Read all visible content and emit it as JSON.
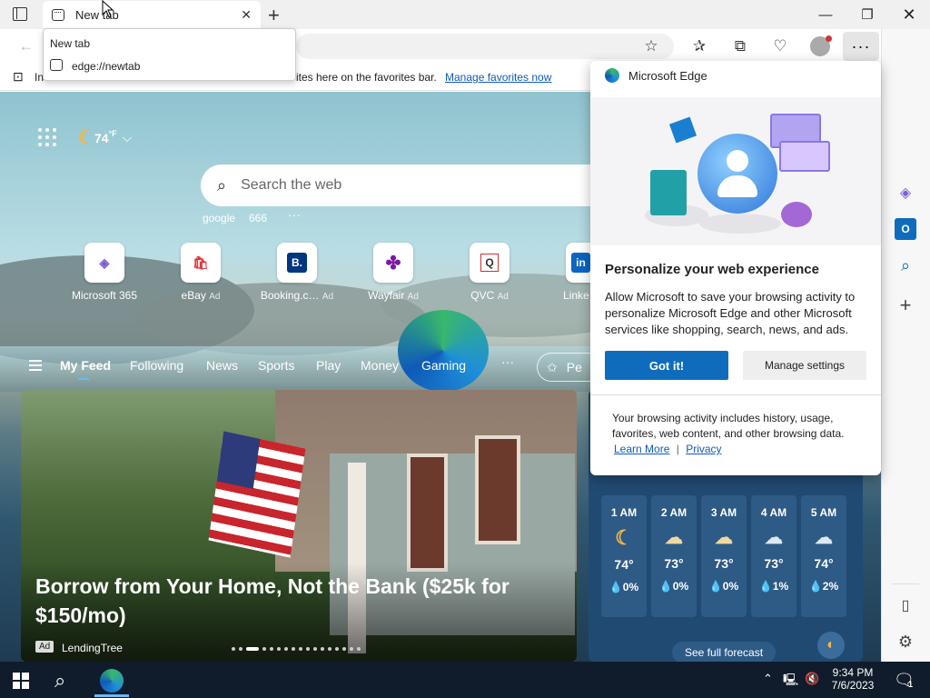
{
  "browser": {
    "tab_title": "New tab",
    "tab_tooltip": {
      "title": "New tab",
      "url": "edge://newtab"
    },
    "favorites_bar": {
      "prefix": "In",
      "message": "ites here on the favorites bar.",
      "link": "Manage favorites now"
    }
  },
  "newtab": {
    "weather_temp": "74",
    "weather_unit": "°F",
    "search_placeholder": "Search the web",
    "quick_links": [
      "google",
      "666"
    ],
    "sites": [
      {
        "label": "Microsoft 365",
        "ad": ""
      },
      {
        "label": "eBay",
        "ad": "Ad"
      },
      {
        "label": "Booking.c…",
        "ad": "Ad"
      },
      {
        "label": "Wayfair",
        "ad": "Ad"
      },
      {
        "label": "QVC",
        "ad": "Ad"
      },
      {
        "label": "Linke",
        "ad": ""
      }
    ],
    "nav_items": [
      "My Feed",
      "Following",
      "News",
      "Sports",
      "Play",
      "Money",
      "Gaming"
    ],
    "personalize_short": "Pe",
    "feature_card": {
      "title": "Borrow from Your Home, Not the Bank ($25k for $150/mo)",
      "ad_badge": "Ad",
      "source": "LendingTree"
    },
    "weather_card": {
      "hours": [
        {
          "time": "1 AM",
          "temp": "74°",
          "precip": "0%",
          "icon": "moon-icon"
        },
        {
          "time": "2 AM",
          "temp": "73°",
          "precip": "0%",
          "icon": "partly-cloudy-night-icon"
        },
        {
          "time": "3 AM",
          "temp": "73°",
          "precip": "0%",
          "icon": "partly-cloudy-night-icon"
        },
        {
          "time": "4 AM",
          "temp": "73°",
          "precip": "1%",
          "icon": "cloud-icon"
        },
        {
          "time": "5 AM",
          "temp": "74°",
          "precip": "2%",
          "icon": "cloud-icon"
        }
      ],
      "forecast_button": "See full forecast"
    }
  },
  "popup": {
    "brand": "Microsoft Edge",
    "heading": "Personalize your web experience",
    "body": "Allow Microsoft to save your browsing activity to personalize Microsoft Edge and other Microsoft services like shopping, search, news, and ads.",
    "primary_button": "Got it!",
    "secondary_button": "Manage settings",
    "footer": "Your browsing activity includes history, usage, favorites, web content, and other browsing data.",
    "learn_more": "Learn More",
    "separator": "|",
    "privacy": "Privacy"
  },
  "taskbar": {
    "time": "9:34 PM",
    "date": "7/6/2023",
    "notification_count": "1"
  },
  "colors": {
    "accent": "#0f6cbd",
    "link": "#0f5ab9",
    "taskbar": "#101c2b"
  }
}
